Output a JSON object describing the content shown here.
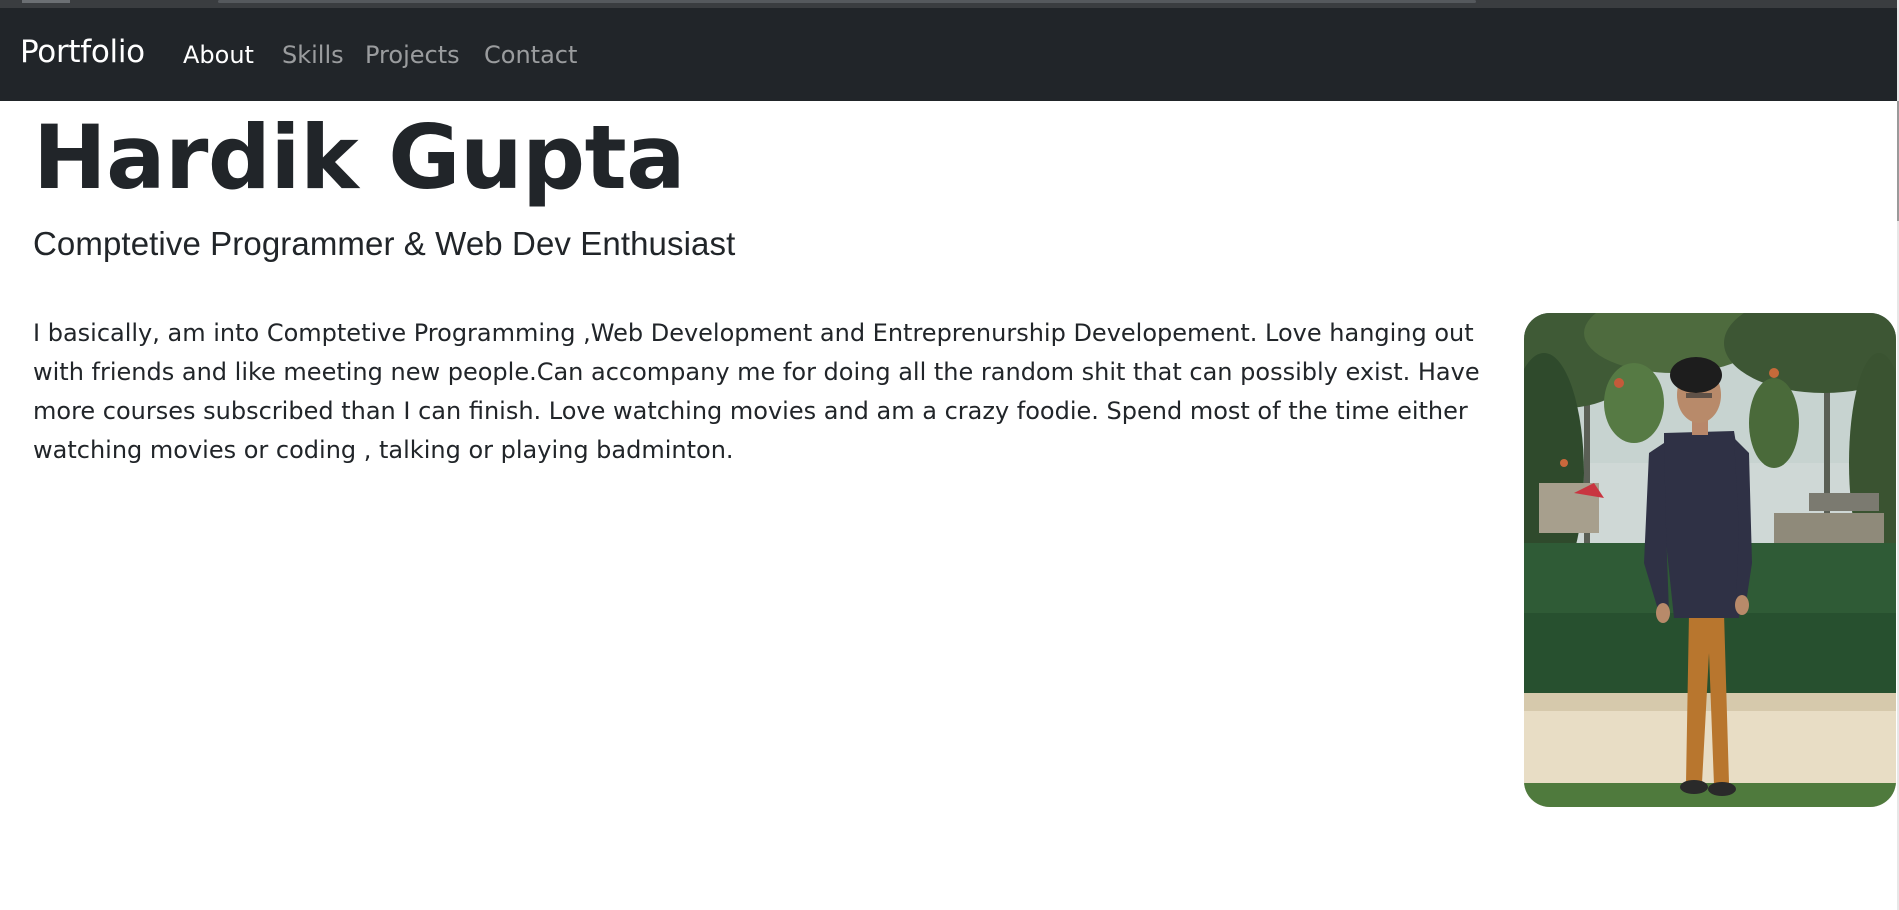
{
  "navbar": {
    "brand": "Portfolio",
    "links": [
      {
        "label": "About",
        "active": true
      },
      {
        "label": "Skills",
        "active": false
      },
      {
        "label": "Projects",
        "active": false
      },
      {
        "label": "Contact",
        "active": false
      }
    ]
  },
  "hero": {
    "name": "Hardik Gupta",
    "tagline": "Comptetive Programmer & Web Dev Enthusiast",
    "about": "I basically, am into Comptetive Programming ,Web Development and Entreprenurship Developement. Love hanging out with friends and like meeting new people.Can accompany me for doing all the random shit that can possibly exist. Have more courses subscribed than I can finish. Love watching movies and am a crazy foodie. Spend most of the time either watching movies or coding , talking or playing badminton."
  },
  "colors": {
    "navbar_bg": "#212529",
    "text": "#212529",
    "nav_inactive": "#8e9195"
  }
}
